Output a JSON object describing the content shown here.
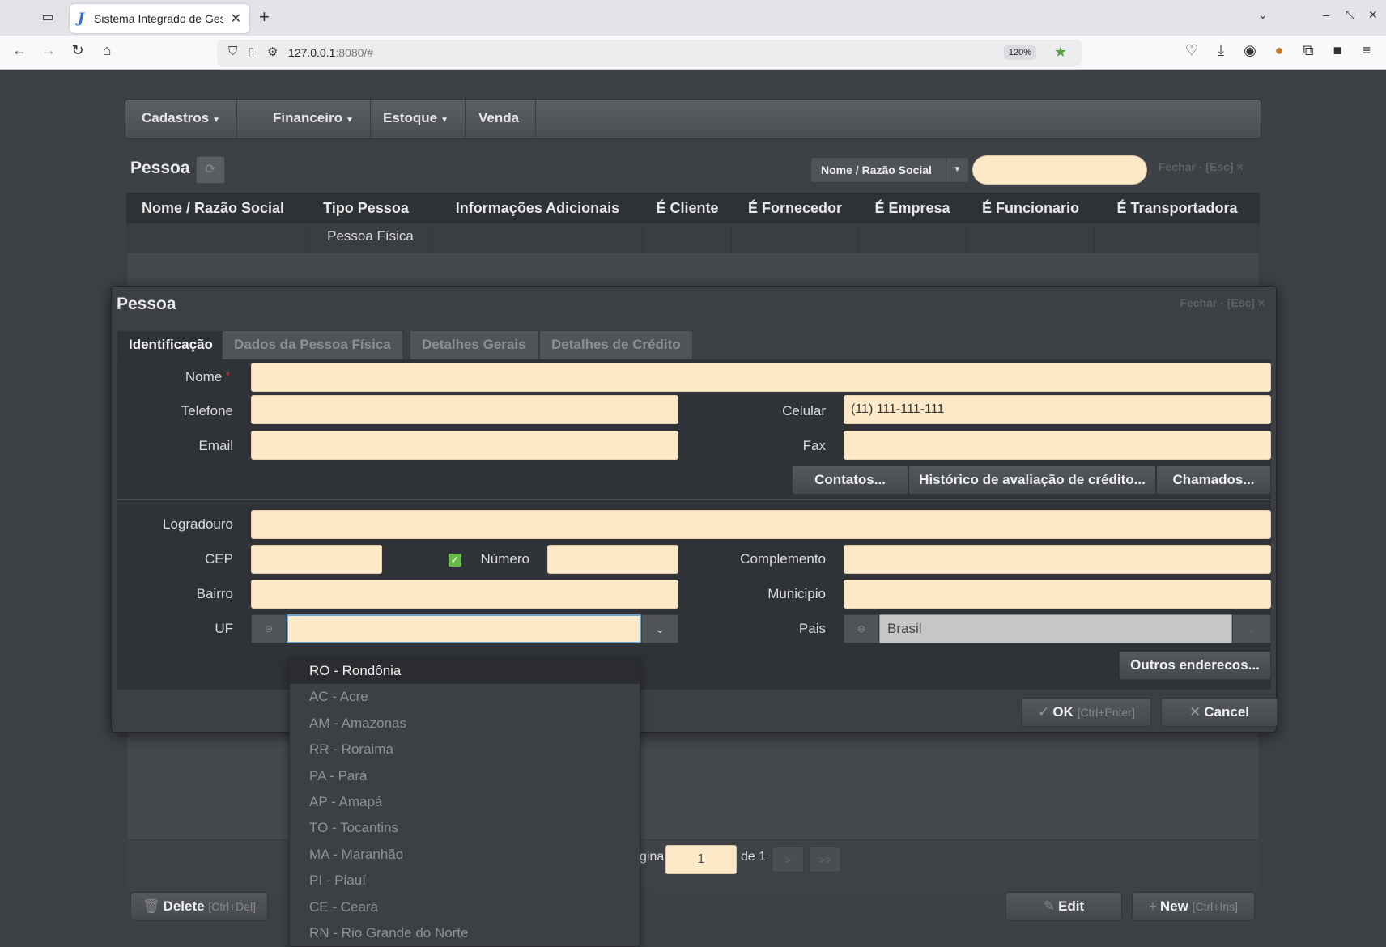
{
  "browser": {
    "tab_title": "Sistema Integrado de Gestã",
    "url_host": "127.0.0.1",
    "url_rest": ":8080/#",
    "zoom": "120%"
  },
  "app_menu": [
    {
      "label": "Cadastros",
      "has_caret": true
    },
    {
      "label": "Financeiro",
      "has_caret": true
    },
    {
      "label": "Estoque",
      "has_caret": true
    },
    {
      "label": "Venda",
      "has_caret": false
    }
  ],
  "list_view": {
    "title": "Pessoa",
    "search_field": "Nome / Razão Social",
    "search_value": "",
    "close_label": "Fechar - [Esc] ×",
    "columns": [
      "Nome / Razão Social",
      "Tipo Pessoa",
      "Informações Adicionais",
      "É Cliente",
      "É Fornecedor",
      "É Empresa",
      "É Funcionario",
      "É Transportadora"
    ],
    "rows": [
      [
        "",
        "Pessoa Física",
        "",
        "",
        "",
        "",
        "",
        ""
      ]
    ],
    "pagination": {
      "page_label": "gina",
      "page": "1",
      "of_label": "de 1",
      "next": ">",
      "last": ">>"
    },
    "delete_label": "Delete",
    "delete_hint": "[Ctrl+Del]",
    "edit_label": "Edit",
    "new_label": "New",
    "new_hint": "[Ctrl+Ins]"
  },
  "modal": {
    "title": "Pessoa",
    "close_label": "Fechar - [Esc] ×",
    "tabs": [
      "Identificação",
      "Dados da Pessoa Física",
      "Detalhes Gerais",
      "Detalhes de Crédito"
    ],
    "labels": {
      "nome": "Nome",
      "telefone": "Telefone",
      "celular": "Celular",
      "email": "Email",
      "fax": "Fax",
      "logradouro": "Logradouro",
      "cep": "CEP",
      "numero": "Número",
      "complemento": "Complemento",
      "bairro": "Bairro",
      "municipio": "Municipio",
      "uf": "UF",
      "pais": "Pais"
    },
    "values": {
      "nome": "",
      "telefone": "",
      "celular": "(11) 111-111-111",
      "email": "",
      "fax": "",
      "logradouro": "",
      "cep": "",
      "numero": "",
      "complemento": "",
      "bairro": "",
      "municipio": "",
      "uf": "",
      "pais": "Brasil"
    },
    "buttons": {
      "contatos": "Contatos...",
      "historico": "Histórico de avaliação de crédito...",
      "chamados": "Chamados...",
      "outros_enderecos": "Outros enderecos...",
      "ok": "OK",
      "ok_hint": "[Ctrl+Enter]",
      "cancel": "Cancel"
    }
  },
  "uf_options": [
    "RO - Rondônia",
    "AC - Acre",
    "AM - Amazonas",
    "RR - Roraima",
    "PA - Pará",
    "AP - Amapá",
    "TO - Tocantins",
    "MA - Maranhão",
    "PI - Piauí",
    "CE - Ceará",
    "RN - Rio Grande do Norte"
  ],
  "uf_selected_index": 0
}
